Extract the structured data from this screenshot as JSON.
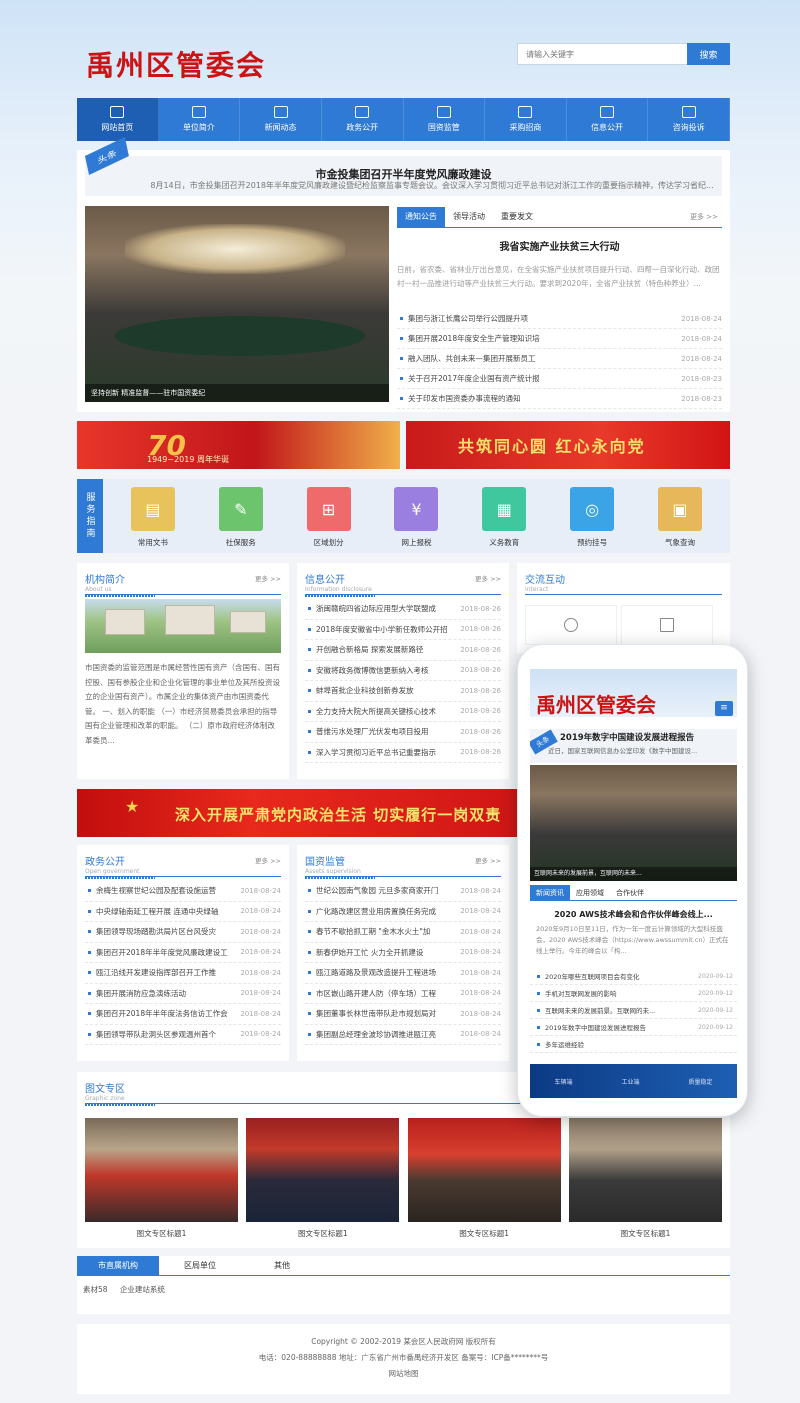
{
  "site": {
    "title": "禹州区管委会"
  },
  "search": {
    "placeholder": "请输入关键字",
    "button": "搜索"
  },
  "nav": [
    {
      "label": "网站首页",
      "icon": "home-icon"
    },
    {
      "label": "单位简介",
      "icon": "list-icon"
    },
    {
      "label": "新闻动态",
      "icon": "newspaper-icon"
    },
    {
      "label": "政务公开",
      "icon": "building-icon"
    },
    {
      "label": "国资监管",
      "icon": "video-icon"
    },
    {
      "label": "采购招商",
      "icon": "users-icon"
    },
    {
      "label": "信息公开",
      "icon": "monitor-icon"
    },
    {
      "label": "咨询投诉",
      "icon": "mail-icon"
    }
  ],
  "headline": {
    "tag": "头条",
    "title": "市金投集团召开半年度党风廉政建设",
    "summary": "8月14日，市金投集团召开2018年半年度党风廉政建设暨纪检监察监事专题会议。会议深入学习贯彻习近平总书记对浙江工作的重要指示精神，传达学习省纪..."
  },
  "slider": {
    "caption": "坚持创新 精准监督——驻市国资委纪"
  },
  "notice": {
    "tabs": [
      "通知公告",
      "领导活动",
      "重要发文"
    ],
    "more": "更多 >>",
    "feature_title": "我省实施产业扶贫三大行动",
    "feature_summary": "日前，省农委、省林业厅出台意见，在全省实施产业扶贫项目提升行动、四帮一自深化行动、政团村一村一品推进行动等产业扶贫三大行动。要求到2020年，全省产业扶贫（特色种养业）...",
    "items": [
      {
        "title": "集团与浙江长鹰公司举行公园提升项",
        "date": "2018-08-24"
      },
      {
        "title": "集团开展2018年度安全生产管理知识培",
        "date": "2018-08-24"
      },
      {
        "title": "融入团队、共创未来—集团开展新员工",
        "date": "2018-08-24"
      },
      {
        "title": "关于召开2017年度企业国有资产统计报",
        "date": "2018-08-23"
      },
      {
        "title": "关于印发市国资委办事流程的通知",
        "date": "2018-08-23"
      }
    ]
  },
  "banners": {
    "b1_text": "70",
    "b1_sub": "1949~2019 周年华诞",
    "b2_text": "共筑同心圆  红心永向党"
  },
  "services": {
    "label": "服务指南",
    "items": [
      {
        "label": "常用文书",
        "color": "#e8c35c",
        "icon": "document-icon"
      },
      {
        "label": "社保服务",
        "color": "#6cc46c",
        "icon": "form-icon"
      },
      {
        "label": "区域划分",
        "color": "#ef6a6a",
        "icon": "org-chart-icon"
      },
      {
        "label": "网上报税",
        "color": "#9b7fe0",
        "icon": "tax-icon"
      },
      {
        "label": "义务教育",
        "color": "#3fc79d",
        "icon": "book-icon"
      },
      {
        "label": "预约挂号",
        "color": "#3aa4e6",
        "icon": "share-icon"
      },
      {
        "label": "气象查询",
        "color": "#e6b85a",
        "icon": "weather-icon"
      }
    ]
  },
  "about": {
    "title": "机构简介",
    "en": "About us",
    "more": "更多 >>",
    "text": "市国资委的监管范围是市属经营性国有资产（含国有、国有控股、国有参股企业和企业化管理的事业单位及其所投资设立的企业国有资产）。市属企业的集体资产由市国资委代管。 一、划入的职能 （一）市经济贸易委员会承担的指导国有企业管理和改革的职能。 （二）原市政府经济体制改革委员..."
  },
  "info": {
    "title": "信息公开",
    "en": "Information disclosure",
    "more": "更多 >>",
    "items": [
      {
        "title": "浙闽赣皖四省边际应用型大学联盟成",
        "date": "2018-08-26"
      },
      {
        "title": "2018年度安徽省中小学新任教师公开招",
        "date": "2018-08-26"
      },
      {
        "title": "开创融合新格局 探索发展新路径",
        "date": "2018-08-26"
      },
      {
        "title": "安徽将政务微博微信更新纳入考核",
        "date": "2018-08-26"
      },
      {
        "title": "蚌埠首批企业科技创新券发放",
        "date": "2018-08-26"
      },
      {
        "title": "全力支持大院大所提高关键核心技术",
        "date": "2018-08-26"
      },
      {
        "title": "普维污水处理厂光伏发电项目投用",
        "date": "2018-08-26"
      },
      {
        "title": "深入学习贯彻习近平总书记重要指示",
        "date": "2018-08-26"
      }
    ]
  },
  "interact": {
    "title": "交流互动",
    "en": "interact"
  },
  "red_banner": {
    "text": "深入开展严肃党内政治生活 切实履行一岗双责"
  },
  "gov": {
    "title": "政务公开",
    "en": "Open government",
    "more": "更多 >>",
    "items": [
      {
        "title": "余梅生视察世纪公园及配套设施运营",
        "date": "2018-08-24"
      },
      {
        "title": "中央绿轴南延工程开展 连通中央绿轴",
        "date": "2018-08-24"
      },
      {
        "title": "集团领导现场踏勘洪局片区台风受灾",
        "date": "2018-08-24"
      },
      {
        "title": "集团召开2018年半年度党风廉政建设工",
        "date": "2018-08-24"
      },
      {
        "title": "瓯江沿线开发建设指挥部召开工作推",
        "date": "2018-08-24"
      },
      {
        "title": "集团开展消防应急演练活动",
        "date": "2018-08-24"
      },
      {
        "title": "集团召开2018年半年度法务信访工作会",
        "date": "2018-08-24"
      },
      {
        "title": "集团领导带队赴洞头区参观温州首个",
        "date": "2018-08-24"
      }
    ]
  },
  "assets": {
    "title": "国资监管",
    "en": "Assets supervision",
    "more": "更多 >>",
    "items": [
      {
        "title": "世纪公园南气象园 元旦多家商家开门",
        "date": "2018-08-24"
      },
      {
        "title": "广化路改建区营业用房置换任务完成",
        "date": "2018-08-24"
      },
      {
        "title": "春节不歇拾抓工期 \"金木水火土\"加",
        "date": "2018-08-24"
      },
      {
        "title": "新春伊始开工忙 火力全开抓建设",
        "date": "2018-08-24"
      },
      {
        "title": "瓯江路道路及景观改造提升工程进场",
        "date": "2018-08-24"
      },
      {
        "title": "市区嵌山路开建人防（停车场）工程",
        "date": "2018-08-24"
      },
      {
        "title": "集团董事长林世南带队赴市规划局对",
        "date": "2018-08-24"
      },
      {
        "title": "集团副总经理金波珍协调推进瓯江亮",
        "date": "2018-08-24"
      }
    ]
  },
  "phone": {
    "title": "禹州区管委会",
    "hl_tag": "头条",
    "hl_title": "2019年数字中国建设发展进程报告",
    "hl_summary": "近日，国家互联网信息办公室印发《数字中国建设...",
    "photo_caption": "互联网未来的发展前景，互联网的未来...",
    "tabs": [
      "新闻资讯",
      "应用领域",
      "合作伙伴"
    ],
    "feature_title": "2020 AWS技术峰会和合作伙伴峰会线上...",
    "feature_summary": "2020年9月10日至11日，作为一年一度云计算领域的大型科技盛会，2020 AWS技术峰会（https://www.awssummit.cn）正式在线上举行。今年的峰会以「构...",
    "items": [
      {
        "title": "2020年哪些互联网项目会有变化",
        "date": "2020-09-12"
      },
      {
        "title": "手机对互联网发展的影响",
        "date": "2020-09-12"
      },
      {
        "title": "互联网未来的发展前景。互联网的未...",
        "date": "2020-09-12"
      },
      {
        "title": "2019年数字中国建设发展进程报告",
        "date": "2020-09-12"
      },
      {
        "title": "多年运维经验",
        "date": ""
      }
    ],
    "footer": [
      "车辆端",
      "工业端",
      "质量稳定"
    ]
  },
  "gallery": {
    "title": "图文专区",
    "en": "Graphic zone",
    "items": [
      {
        "caption": "图文专区标题1"
      },
      {
        "caption": "图文专区标题1"
      },
      {
        "caption": "图文专区标题1"
      },
      {
        "caption": "图文专区标题1"
      }
    ]
  },
  "links": {
    "tabs": [
      "市直属机构",
      "区局单位",
      "其他"
    ],
    "items": [
      "素材58",
      "企业建站系统"
    ]
  },
  "footer": {
    "copyright": "Copyright © 2002-2019 某会区人民政府网 版权所有",
    "contact": "电话：020-88888888    地址：广东省广州市番禺经济开发区    备案号：ICP备********号",
    "sitemap": "网站地图"
  }
}
